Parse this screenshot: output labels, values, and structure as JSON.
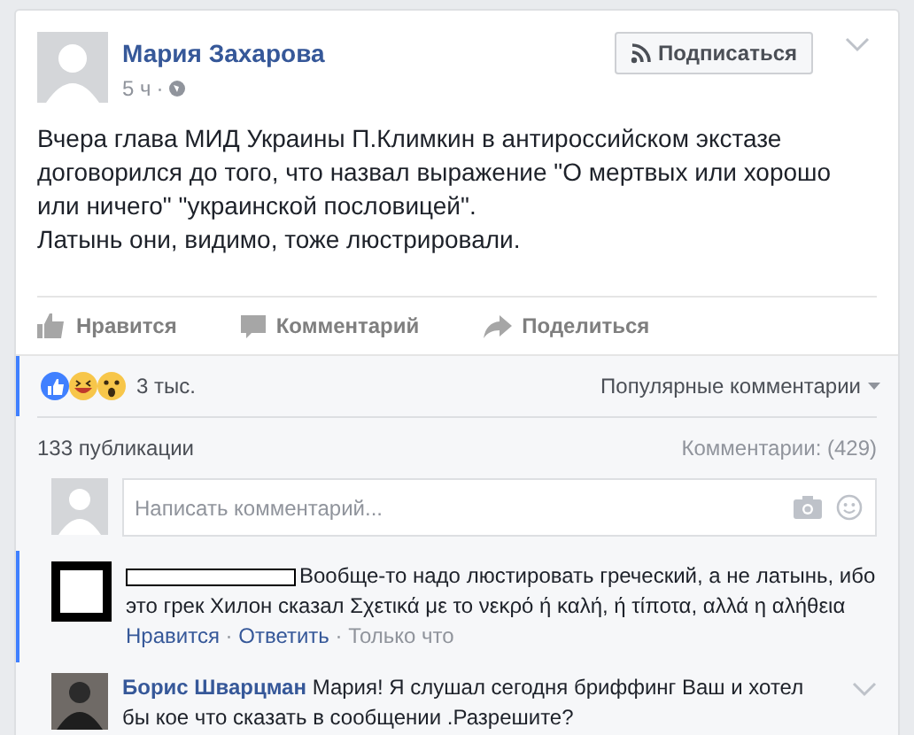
{
  "post": {
    "author": "Мария Захарова",
    "time": "5 ч",
    "separator": "·",
    "follow_button": "Подписаться",
    "text": [
      "Вчера глава МИД Украины П.Климкин в антироссийском экстазе договорился до того, что назвал выражение \"О мертвых или хорошо или ничего\" \"украинской пословицей\".",
      "Латынь они, видимо, тоже люстрировали."
    ]
  },
  "actions": [
    "Нравится",
    "Комментарий",
    "Поделиться"
  ],
  "reactions": {
    "count": "3 тыс.",
    "sort": "Популярные комментарии"
  },
  "stats": {
    "shares": "133 публикации",
    "comments": "Комментарии: (429)"
  },
  "comment_field": {
    "placeholder": "Написать комментарий..."
  },
  "comments": [
    {
      "author_redacted": true,
      "highlighted": true,
      "text": "Вообще-то надо люстировать греческий, а не латынь, ибо это грек Хилон сказал Σχετικά με το νεκρό ή καλή, ή τίποτα, αλλά η αλήθεια",
      "links": [
        "Нравится",
        "Ответить"
      ],
      "separator": "·",
      "time": "Только что"
    },
    {
      "author_redacted": false,
      "author": "Борис Шварцман",
      "highlighted": false,
      "text": "Мария! Я слушал сегодня бриффинг Ваш и хотел бы кое что сказать в сообщении .Разрешите?"
    }
  ]
}
